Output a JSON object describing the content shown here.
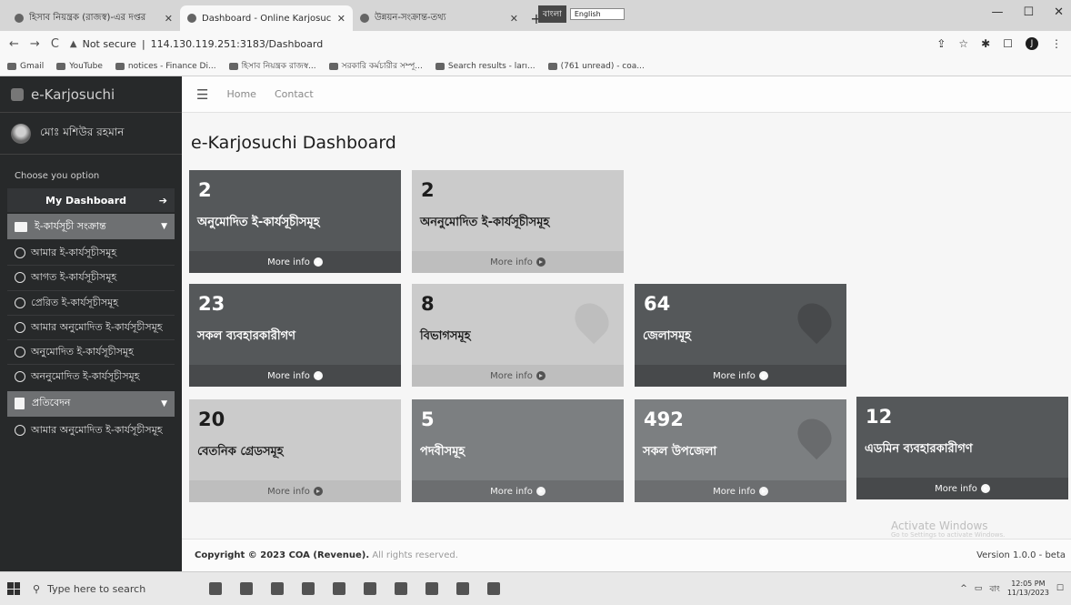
{
  "browser": {
    "tabs": [
      {
        "label": "হিসাব নিয়ন্ত্রক (রাজস্ব)-এর দপ্তর",
        "active": false
      },
      {
        "label": "Dashboard - Online Karjosuchi",
        "active": true
      },
      {
        "label": "উন্নয়ন-সংক্রান্ত-তথ্য",
        "active": false
      }
    ],
    "new_tab": "+",
    "keyboard_label": "বাংলা",
    "keyboard_lang": "English",
    "window_controls": [
      "—",
      "☐",
      "✕"
    ],
    "security_label": "Not secure",
    "url": "114.130.119.251:3183/Dashboard",
    "bookmarks": [
      "Gmail",
      "YouTube",
      "notices - Finance Di...",
      "হিসাব নিয়ন্ত্রক রাজস্ব...",
      "সরকারি কর্মচারীর সম্পূ...",
      "Search results - ları...",
      "(761 unread) - coa..."
    ],
    "profile_initial": "J"
  },
  "sidebar": {
    "brand": "e-Karjosuchi",
    "user_name": "মোঃ মশিউর রহমান",
    "choose_label": "Choose you option",
    "my_dashboard": "My Dashboard",
    "my_dashboard_arrow": "➔",
    "group1": "ই-কার্যসূচী সংক্রান্ত",
    "group1_items": [
      "আমার ই-কার্যসূচীসমূহ",
      "আগত ই-কার্যসূচীসমূহ",
      "প্রেরিত ই-কার্যসূচীসমূহ",
      "আমার অনুমোদিত ই-কার্যসূচীসমূহ",
      "অনুমোদিত ই-কার্যসূচীসমূহ",
      "অননুমোদিত ই-কার্যসূচীসমূহ"
    ],
    "group2": "প্রতিবেদন",
    "group2_items": [
      "আমার অনুমোদিত ই-কার্যসূচীসমূহ"
    ]
  },
  "topnav": {
    "home": "Home",
    "contact": "Contact"
  },
  "page_title": "e-Karjosuchi Dashboard",
  "more_info": "More info",
  "boxes": [
    {
      "value": "2",
      "label": "অনুমোদিত ই-কার্যসূচীসমূহ"
    },
    {
      "value": "2",
      "label": "অননুমোদিত ই-কার্যসূচীসমূহ"
    },
    {
      "value": "23",
      "label": "সকল ব্যবহারকারীগণ"
    },
    {
      "value": "8",
      "label": "বিভাগসমূহ"
    },
    {
      "value": "64",
      "label": "জেলাসমূহ"
    },
    {
      "value": "20",
      "label": "বেতনিক গ্রেডসমূহ"
    },
    {
      "value": "5",
      "label": "পদবীসমূহ"
    },
    {
      "value": "492",
      "label": "সকল উপজেলা"
    },
    {
      "value": "12",
      "label": "এডমিন ব্যবহারকারীগণ"
    }
  ],
  "watermark": {
    "title": "Activate Windows",
    "subtitle": "Go to Settings to activate Windows."
  },
  "footer": {
    "copyright": "Copyright © 2023 COA (Revenue).",
    "rights": "All rights reserved.",
    "version": "Version 1.0.0 - beta"
  },
  "taskbar": {
    "search_placeholder": "Type here to search",
    "time": "12:05 PM",
    "date": "11/13/2023",
    "lang": "বাং"
  }
}
